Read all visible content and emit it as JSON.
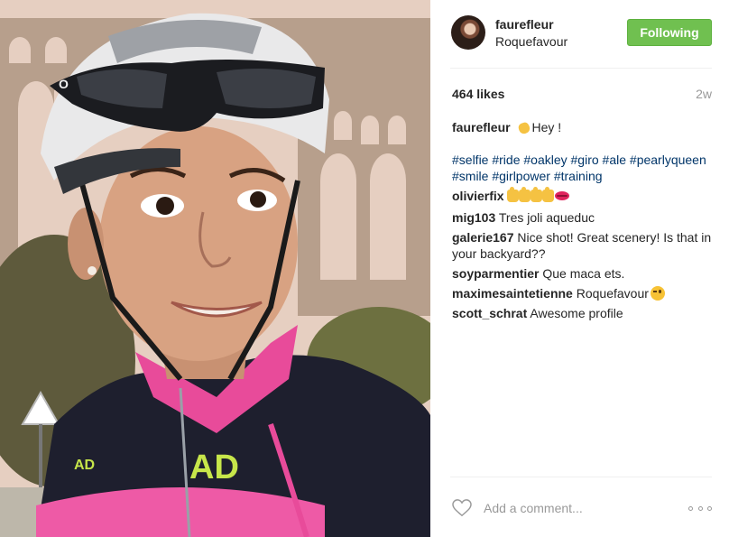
{
  "post": {
    "username": "faurefleur",
    "location": "Roquefavour",
    "follow_label": "Following",
    "likes": "464 likes",
    "time": "2w",
    "caption": {
      "author": "faurefleur",
      "text": "Hey !",
      "hashtags": "#selfie #ride #oakley #giro #ale #pearlyqueen #smile #girlpower #training"
    },
    "comments": [
      {
        "author": "olivierfix",
        "text": ""
      },
      {
        "author": "mig103",
        "text": "Tres joli aqueduc"
      },
      {
        "author": "galerie167",
        "text": "Nice shot! Great scenery! Is that in your backyard??"
      },
      {
        "author": "soyparmentier",
        "text": "Que maca ets."
      },
      {
        "author": "maximesaintetienne",
        "text": "Roquefavour"
      },
      {
        "author": "scott_schrat",
        "text": "Awesome profile"
      }
    ],
    "add_comment_placeholder": "Add a comment..."
  },
  "icons": {
    "heart": "heart-outline-icon",
    "more": "more-options-icon",
    "follow_color": "#70c050"
  }
}
